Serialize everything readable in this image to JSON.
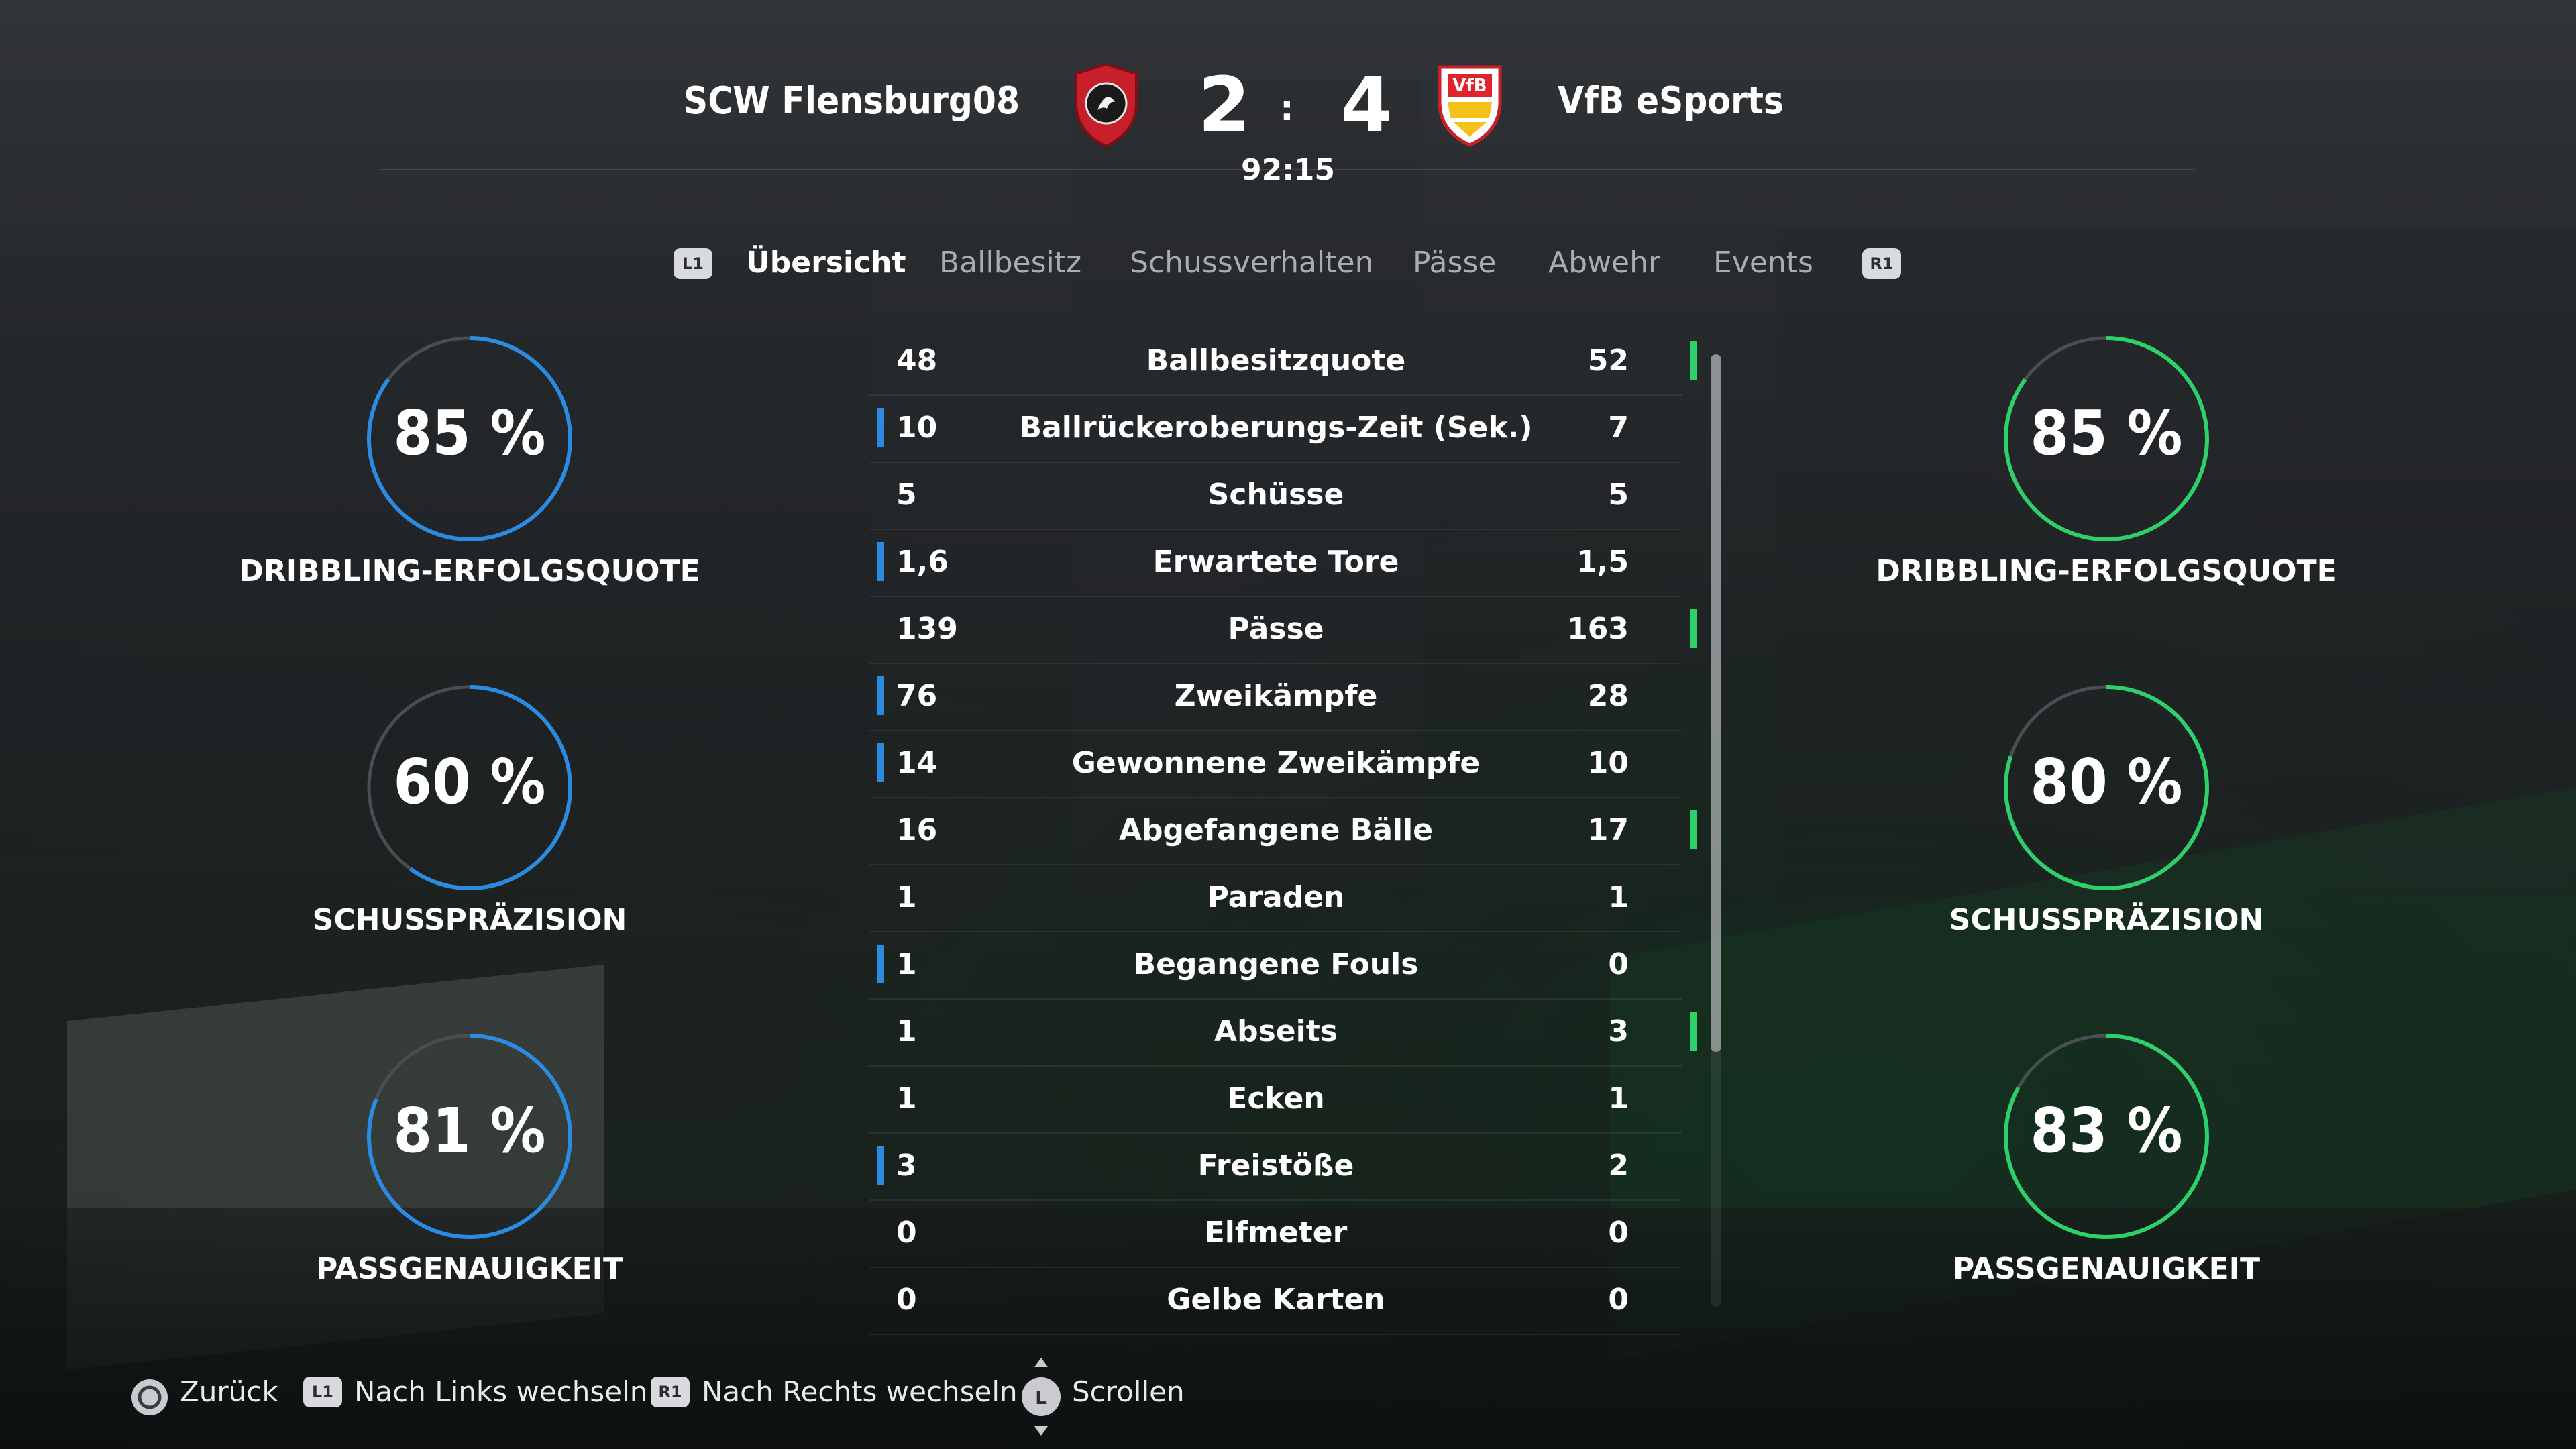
{
  "match": {
    "home_team": "SCW Flensburg08",
    "away_team": "VfB eSports",
    "home_score": "2",
    "away_score": "4",
    "separator": ":",
    "clock": "92:15"
  },
  "tabs": {
    "left_button": "L1",
    "right_button": "R1",
    "items": [
      "Übersicht",
      "Ballbesitz",
      "Schussverhalten",
      "Pässe",
      "Abwehr",
      "Events"
    ],
    "active": "Übersicht"
  },
  "rings": {
    "home": [
      {
        "value": "85 %",
        "fraction": 0.85,
        "label": "DRIBBLING-ERFOLGSQUOTE"
      },
      {
        "value": "60 %",
        "fraction": 0.6,
        "label": "SCHUSSPRÄZISION"
      },
      {
        "value": "81 %",
        "fraction": 0.81,
        "label": "PASSGENAUIGKEIT"
      }
    ],
    "away": [
      {
        "value": "85 %",
        "fraction": 0.85,
        "label": "DRIBBLING-ERFOLGSQUOTE"
      },
      {
        "value": "80 %",
        "fraction": 0.8,
        "label": "SCHUSSPRÄZISION"
      },
      {
        "value": "83 %",
        "fraction": 0.83,
        "label": "PASSGENAUIGKEIT"
      }
    ]
  },
  "stats": [
    {
      "name": "Ballbesitzquote",
      "home": "48",
      "away": "52",
      "leader": "away"
    },
    {
      "name": "Ballrückeroberungs-Zeit (Sek.)",
      "home": "10",
      "away": "7",
      "leader": "home"
    },
    {
      "name": "Schüsse",
      "home": "5",
      "away": "5",
      "leader": "none"
    },
    {
      "name": "Erwartete Tore",
      "home": "1,6",
      "away": "1,5",
      "leader": "home"
    },
    {
      "name": "Pässe",
      "home": "139",
      "away": "163",
      "leader": "away"
    },
    {
      "name": "Zweikämpfe",
      "home": "76",
      "away": "28",
      "leader": "home"
    },
    {
      "name": "Gewonnene Zweikämpfe",
      "home": "14",
      "away": "10",
      "leader": "home"
    },
    {
      "name": "Abgefangene Bälle",
      "home": "16",
      "away": "17",
      "leader": "away"
    },
    {
      "name": "Paraden",
      "home": "1",
      "away": "1",
      "leader": "none"
    },
    {
      "name": "Begangene Fouls",
      "home": "1",
      "away": "0",
      "leader": "home"
    },
    {
      "name": "Abseits",
      "home": "1",
      "away": "3",
      "leader": "away"
    },
    {
      "name": "Ecken",
      "home": "1",
      "away": "1",
      "leader": "none"
    },
    {
      "name": "Freistöße",
      "home": "3",
      "away": "2",
      "leader": "home"
    },
    {
      "name": "Elfmeter",
      "home": "0",
      "away": "0",
      "leader": "none"
    },
    {
      "name": "Gelbe Karten",
      "home": "0",
      "away": "0",
      "leader": "none"
    }
  ],
  "footer": {
    "back": "Zurück",
    "left_button": "L1",
    "switch_left": "Nach Links wechseln",
    "right_button": "R1",
    "switch_right": "Nach Rechts wechseln",
    "stick_button": "L",
    "scroll": "Scrollen"
  },
  "colors": {
    "home_accent": "#2a8be0",
    "away_accent": "#2fcf6a",
    "ring_track": "#4a4e52"
  }
}
